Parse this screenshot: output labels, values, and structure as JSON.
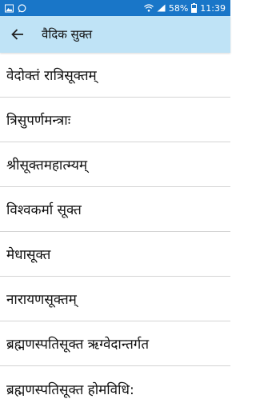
{
  "status_bar": {
    "battery": "58%",
    "time": "11:39",
    "icons": [
      "image-icon",
      "whatsapp-icon",
      "wifi-icon",
      "signal-icon",
      "battery-icon"
    ]
  },
  "app_bar": {
    "title": "वैदिक सुक्त",
    "back_icon": "arrow-left-icon"
  },
  "list": {
    "items": [
      {
        "label": "वेदोक्तं रात्रिसूक्तम्"
      },
      {
        "label": "त्रिसुपर्णमन्त्राः"
      },
      {
        "label": "श्रीसूक्तमहात्म्यम्"
      },
      {
        "label": "विश्वकर्मा सूक्त"
      },
      {
        "label": "मेधासूक्त"
      },
      {
        "label": "नारायणसूक्तम्"
      },
      {
        "label": "ब्रह्मणस्पतिसूक्त ऋग्वेदान्तर्गत"
      },
      {
        "label": "ब्रह्मणस्पतिसूक्त होमविधि:"
      }
    ]
  },
  "colors": {
    "status_bar": "#1976c8",
    "app_bar": "#bfe3f6",
    "divider": "#d4d4d4"
  }
}
